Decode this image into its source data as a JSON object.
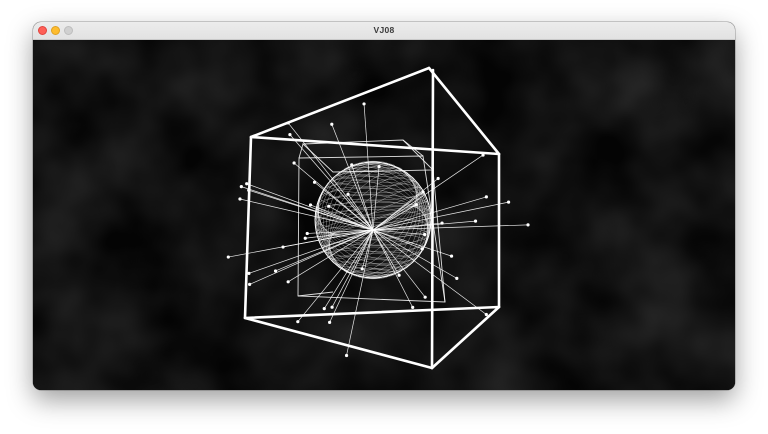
{
  "window": {
    "title": "VJ08"
  },
  "colors": {
    "background": "#000000",
    "stroke": "#ffffff",
    "close": "#fe5f57",
    "minimize": "#febc2e",
    "maximize": "#d0d0d0"
  },
  "icons": {
    "close": "close-button",
    "minimize": "minimize-button",
    "maximize": "maximize-button"
  }
}
